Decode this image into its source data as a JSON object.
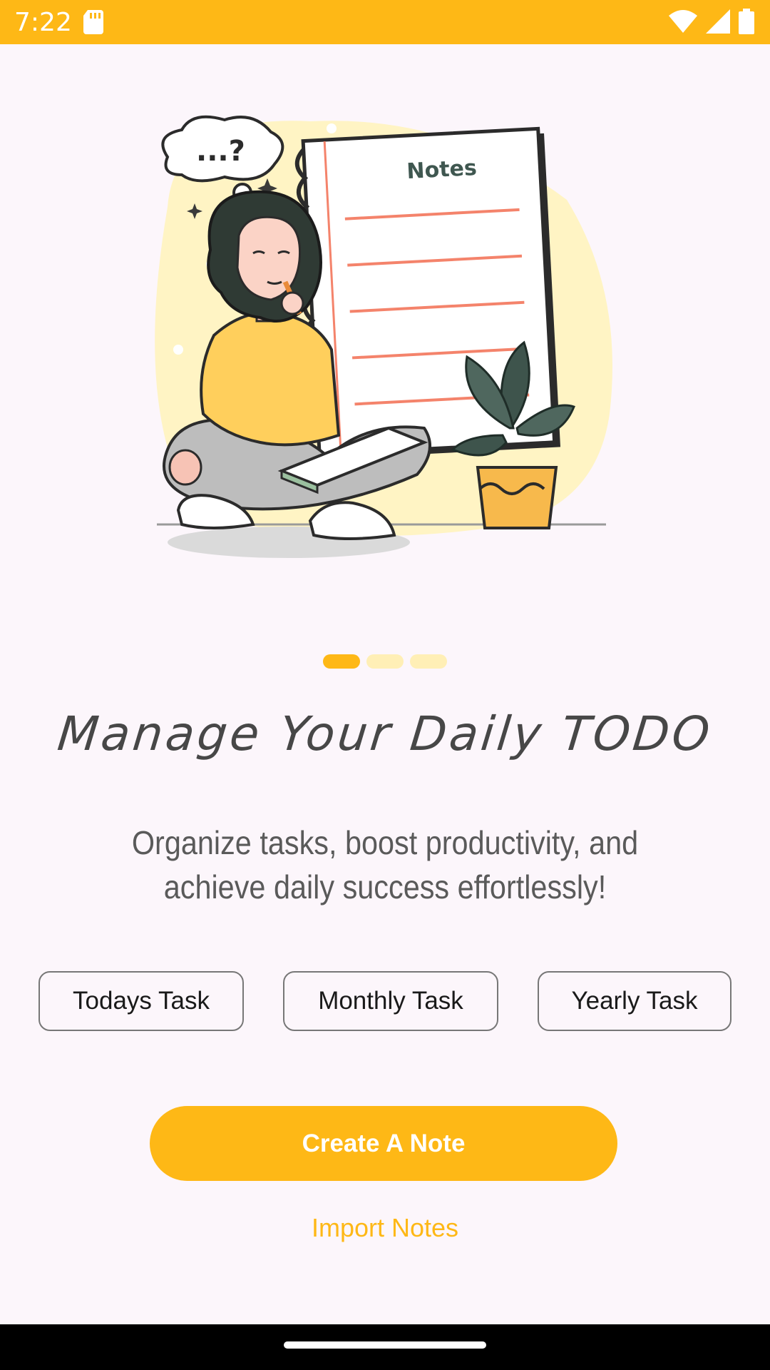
{
  "status_bar": {
    "time": "7:22",
    "icons": [
      "sd-card-icon",
      "wifi-icon",
      "signal-icon",
      "battery-icon"
    ],
    "background": "#FEB816"
  },
  "illustration": {
    "icon": "woman-thinking-notes-illustration",
    "notes_label": "Notes",
    "thought": "...?"
  },
  "pager": {
    "count": 3,
    "active_index": 0
  },
  "headline": "Manage Your Daily TODO",
  "subtitle": {
    "line1": "Organize tasks, boost productivity, and",
    "line2": "achieve daily success effortlessly!"
  },
  "chips": [
    {
      "label": "Todays Task"
    },
    {
      "label": "Monthly Task"
    },
    {
      "label": "Yearly Task"
    }
  ],
  "actions": {
    "primary_label": "Create A Note",
    "secondary_label": "Import Notes"
  },
  "colors": {
    "accent": "#FEB816",
    "background": "#FCF6FB",
    "pager_inactive": "#FFEFB6",
    "headline": "#474747"
  }
}
